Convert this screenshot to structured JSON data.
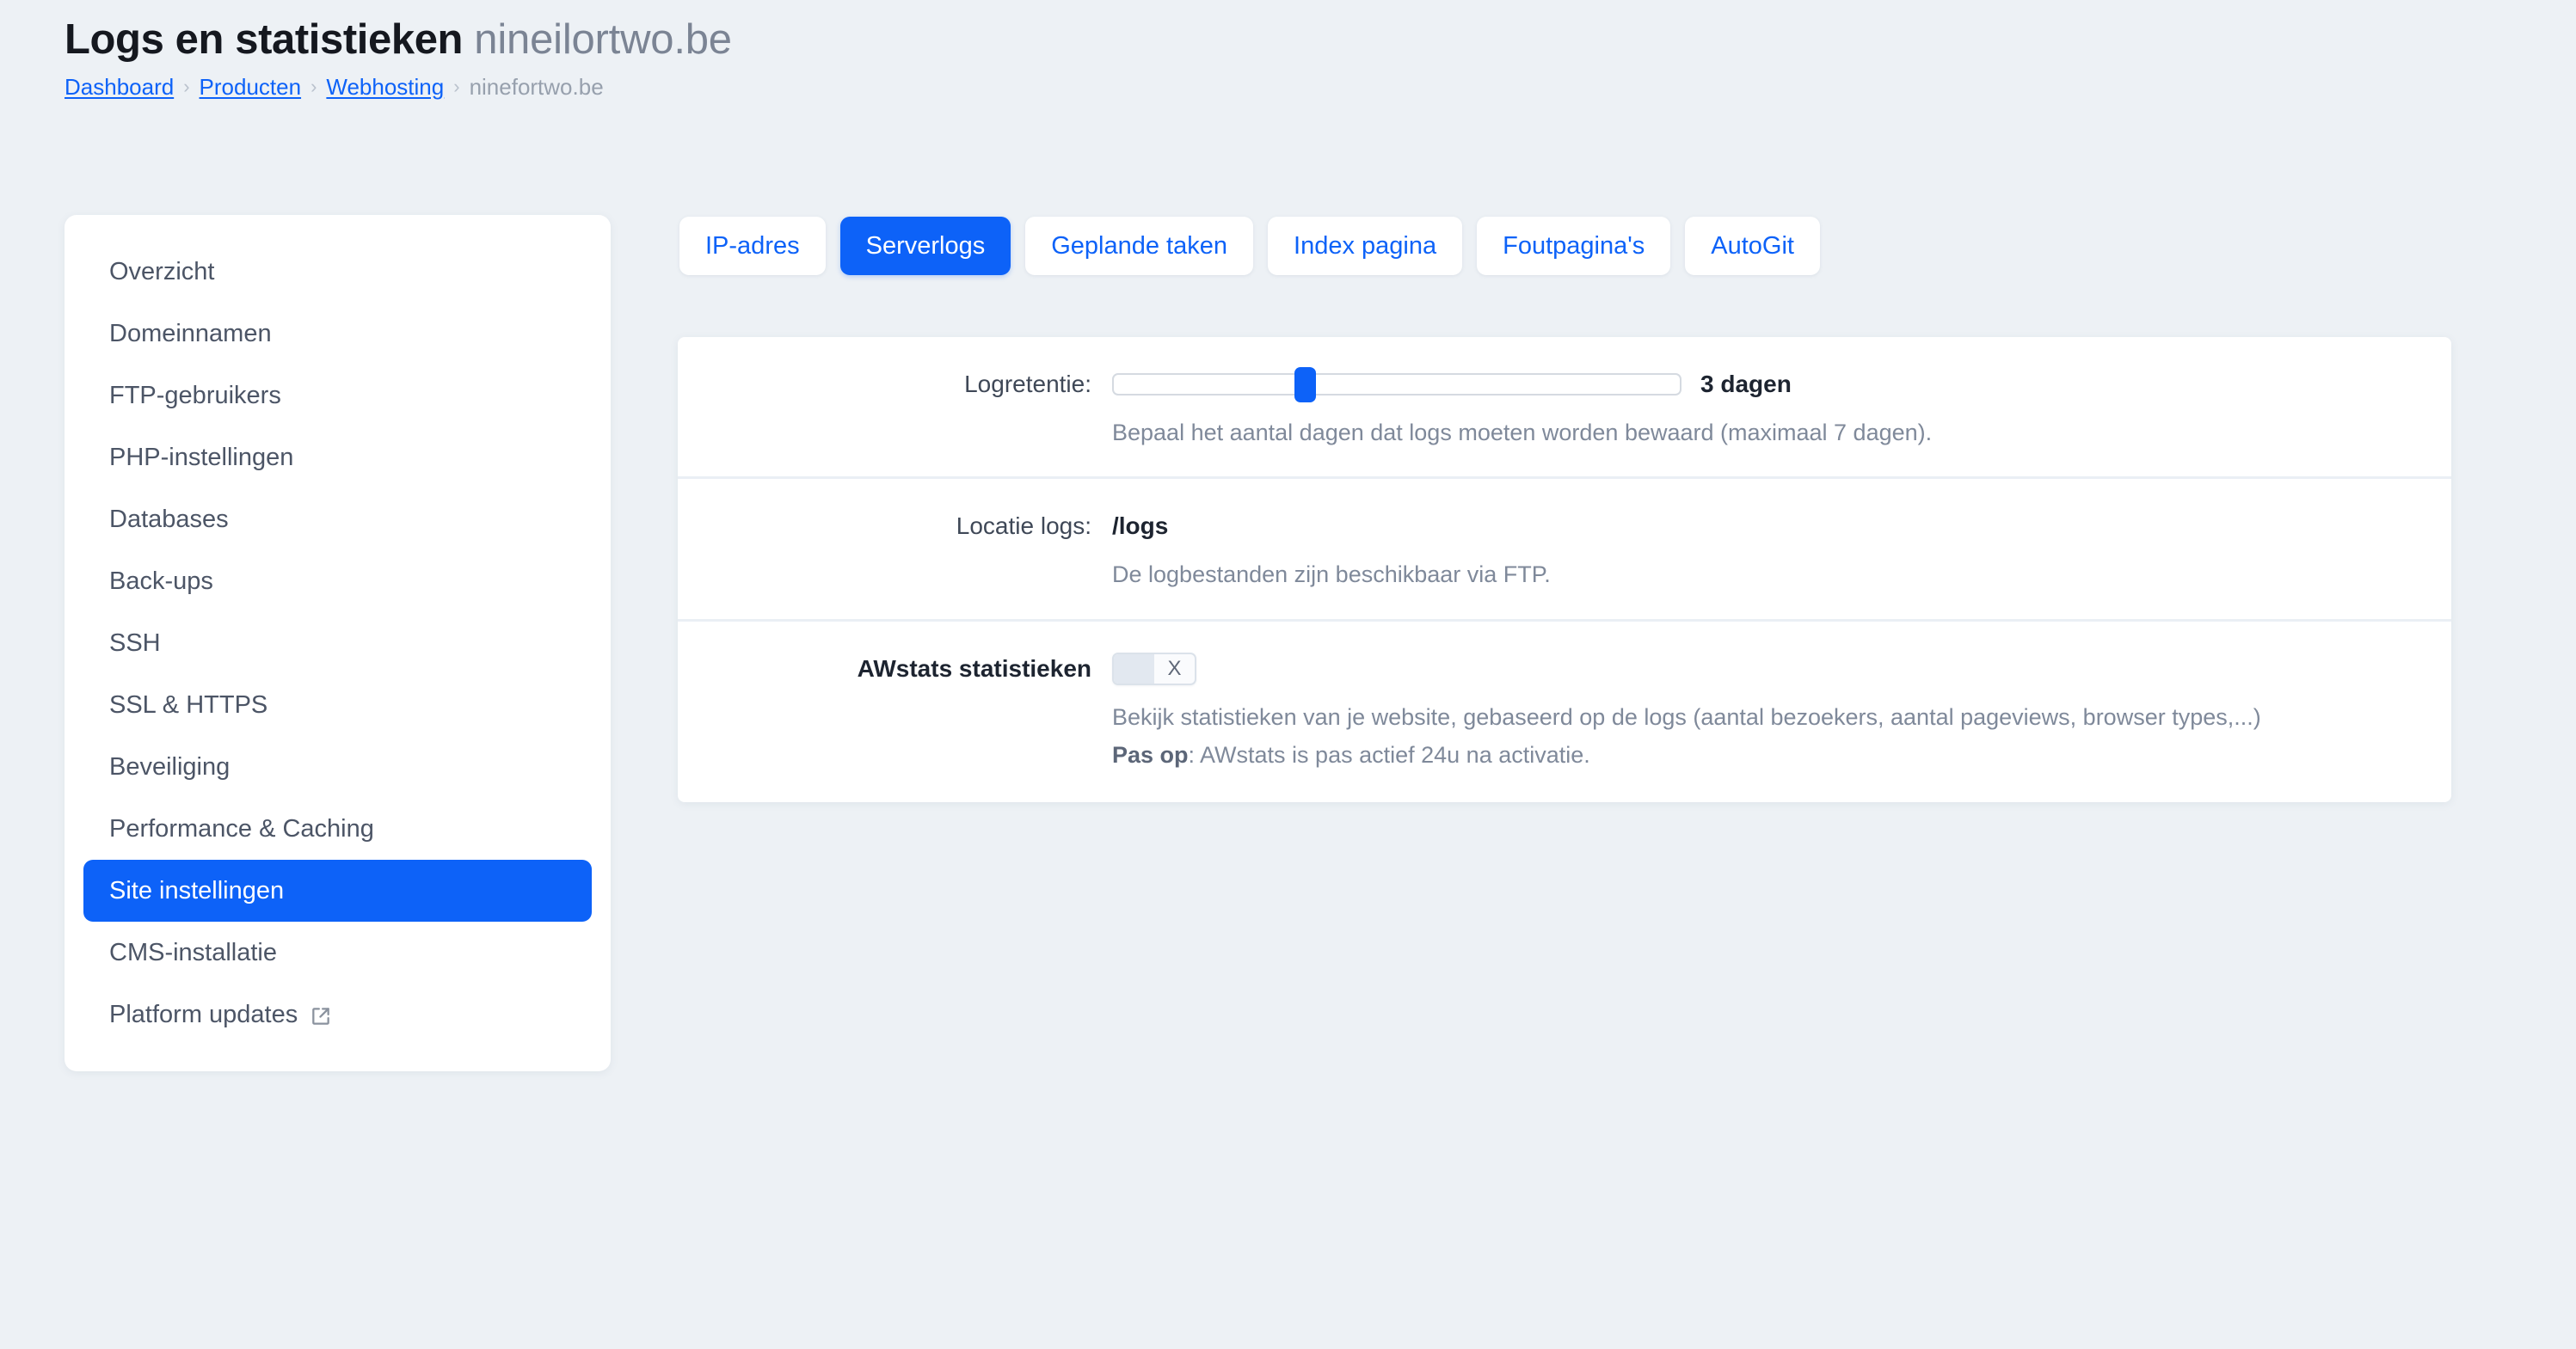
{
  "header": {
    "title_main": "Logs en statistieken",
    "title_domain": "nineilortwo.be",
    "breadcrumb": {
      "dashboard": "Dashboard",
      "producten": "Producten",
      "webhosting": "Webhosting",
      "current": "ninefortwo.be",
      "separator": "›"
    }
  },
  "sidebar": {
    "items": [
      {
        "label": "Overzicht",
        "active": false,
        "external": false
      },
      {
        "label": "Domeinnamen",
        "active": false,
        "external": false
      },
      {
        "label": "FTP-gebruikers",
        "active": false,
        "external": false
      },
      {
        "label": "PHP-instellingen",
        "active": false,
        "external": false
      },
      {
        "label": "Databases",
        "active": false,
        "external": false
      },
      {
        "label": "Back-ups",
        "active": false,
        "external": false
      },
      {
        "label": "SSH",
        "active": false,
        "external": false
      },
      {
        "label": "SSL & HTTPS",
        "active": false,
        "external": false
      },
      {
        "label": "Beveiliging",
        "active": false,
        "external": false
      },
      {
        "label": "Performance & Caching",
        "active": false,
        "external": false
      },
      {
        "label": "Site instellingen",
        "active": true,
        "external": false
      },
      {
        "label": "CMS-installatie",
        "active": false,
        "external": false
      },
      {
        "label": "Platform updates",
        "active": false,
        "external": true
      }
    ]
  },
  "tabs": [
    {
      "label": "IP-adres",
      "active": false
    },
    {
      "label": "Serverlogs",
      "active": true
    },
    {
      "label": "Geplande taken",
      "active": false
    },
    {
      "label": "Index pagina",
      "active": false
    },
    {
      "label": "Foutpagina's",
      "active": false
    },
    {
      "label": "AutoGit",
      "active": false
    }
  ],
  "main": {
    "log_retention": {
      "label": "Logretentie:",
      "value_text": "3 dagen",
      "slider_value": 3,
      "slider_min": 1,
      "slider_max": 7,
      "hint": "Bepaal het aantal dagen dat logs moeten worden bewaard (maximaal 7 dagen)."
    },
    "log_location": {
      "label": "Locatie logs:",
      "value": "/logs",
      "hint": "De logbestanden zijn beschikbaar via FTP."
    },
    "awstats": {
      "label": "AWstats statistieken",
      "toggle_state": "X",
      "toggle_on": false,
      "hint_line1": "Bekijk statistieken van je website, gebaseerd op de logs (aantal bezoekers, aantal pageviews, browser types,...)",
      "warning_label": "Pas op",
      "warning_text": ": AWstats is pas actief 24u na activatie."
    }
  },
  "icons": {
    "external_link": "external-link-icon"
  },
  "colors": {
    "accent": "#0d62f8",
    "page_background": "#edf1f5",
    "card": "#ffffff",
    "muted_text": "#7f899a",
    "divider": "#eaeff5"
  }
}
